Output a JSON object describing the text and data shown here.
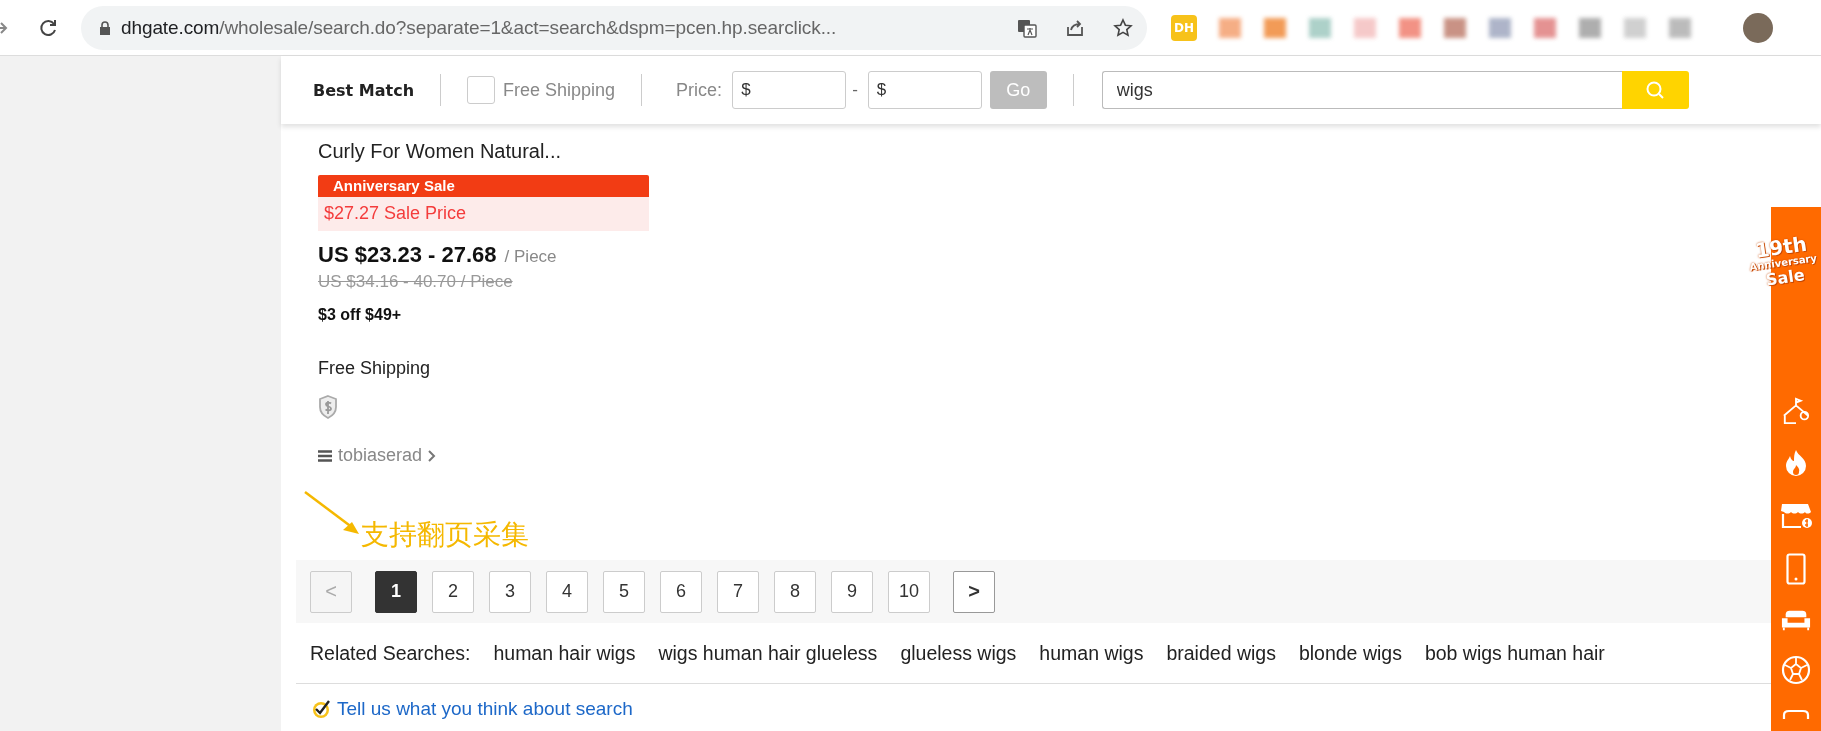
{
  "browser": {
    "url_domain": "dhgate.com",
    "url_path": "/wholesale/search.do?separate=1&act=search&dspm=pcen.hp.searclick...",
    "bookmark_badge": "DH"
  },
  "filter_bar": {
    "sort": "Best Match",
    "free_shipping": {
      "label": "Free Shipping",
      "checked": false
    },
    "price_label": "Price:",
    "price_min": {
      "placeholder": "$"
    },
    "separator": "-",
    "price_max": {
      "placeholder": "$"
    },
    "go_button": {
      "label": "Go",
      "disabled": true
    },
    "search": {
      "value": "wigs"
    }
  },
  "product": {
    "title": "Curly For Women Natural...",
    "promo_tag": "Anniversary Sale",
    "sale_price": "$27.27 Sale Price",
    "price": "US $23.23 - 27.68",
    "unit": "/ Piece",
    "original_price": "US $34.16 - 40.70 / Piece",
    "coupon": "$3 off $49+",
    "shipping": "Free Shipping",
    "seller": "tobiaserad"
  },
  "annotation": "支持翻页采集",
  "pagination": {
    "prev": {
      "label": "<",
      "disabled": true
    },
    "pages": [
      {
        "label": "1",
        "selected": true
      },
      {
        "label": "2",
        "selected": false
      },
      {
        "label": "3",
        "selected": false
      },
      {
        "label": "4",
        "selected": false
      },
      {
        "label": "5",
        "selected": false
      },
      {
        "label": "6",
        "selected": false
      },
      {
        "label": "7",
        "selected": false
      },
      {
        "label": "8",
        "selected": false
      },
      {
        "label": "9",
        "selected": false
      },
      {
        "label": "10",
        "selected": false
      }
    ],
    "next": {
      "label": ">",
      "disabled": false
    }
  },
  "related_searches": {
    "label": "Related Searches:",
    "items": [
      "human hair wigs",
      "wigs human hair glueless",
      "glueless wigs",
      "human wigs",
      "braided wigs",
      "blonde wigs",
      "bob wigs human hair"
    ]
  },
  "feedback": "Tell us what you think about search",
  "sidebar": {
    "badge": [
      "19th",
      "Anniversary",
      "Sale"
    ],
    "icons": [
      {
        "kind": "tent"
      },
      {
        "kind": "fire"
      },
      {
        "kind": "shop"
      },
      {
        "kind": "phone"
      },
      {
        "kind": "sofa"
      },
      {
        "kind": "ball"
      },
      {
        "kind": "partial"
      }
    ]
  }
}
